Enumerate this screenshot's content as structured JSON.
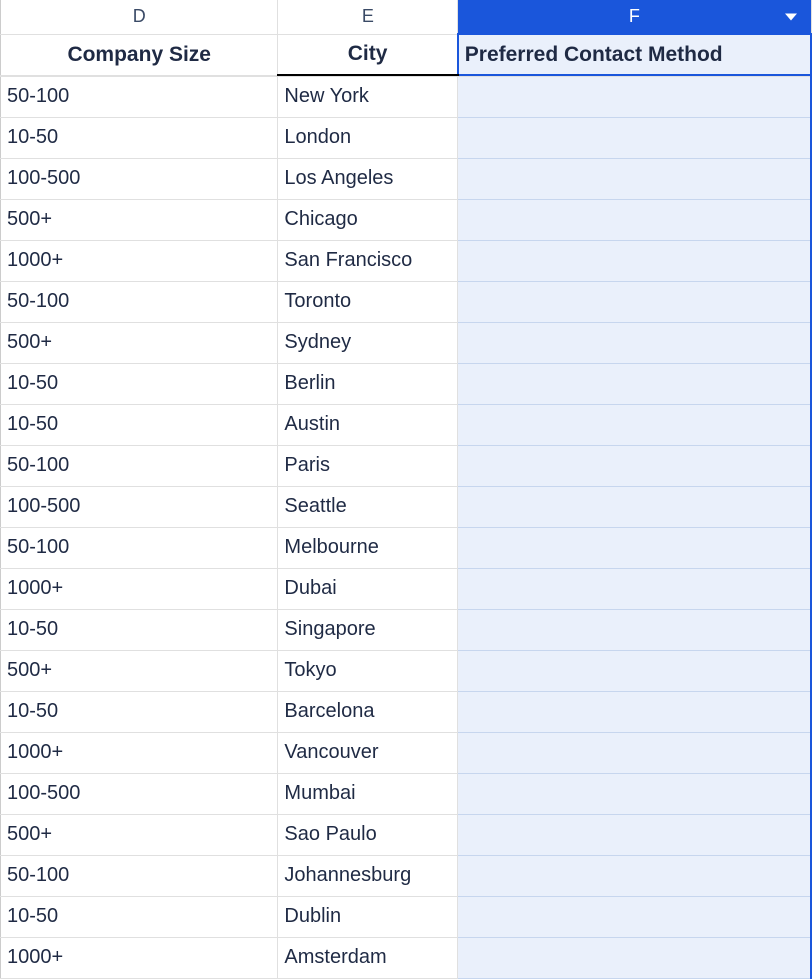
{
  "columns": {
    "d": {
      "letter": "D",
      "header": "Company Size"
    },
    "e": {
      "letter": "E",
      "header": "City"
    },
    "f": {
      "letter": "F",
      "header": "Preferred Contact Method"
    }
  },
  "rows": [
    {
      "company_size": "50-100",
      "city": "New York",
      "preferred_contact": ""
    },
    {
      "company_size": "10-50",
      "city": "London",
      "preferred_contact": ""
    },
    {
      "company_size": "100-500",
      "city": "Los Angeles",
      "preferred_contact": ""
    },
    {
      "company_size": "500+",
      "city": "Chicago",
      "preferred_contact": ""
    },
    {
      "company_size": "1000+",
      "city": "San Francisco",
      "preferred_contact": ""
    },
    {
      "company_size": "50-100",
      "city": "Toronto",
      "preferred_contact": ""
    },
    {
      "company_size": "500+",
      "city": "Sydney",
      "preferred_contact": ""
    },
    {
      "company_size": "10-50",
      "city": "Berlin",
      "preferred_contact": ""
    },
    {
      "company_size": "10-50",
      "city": "Austin",
      "preferred_contact": ""
    },
    {
      "company_size": "50-100",
      "city": "Paris",
      "preferred_contact": ""
    },
    {
      "company_size": "100-500",
      "city": "Seattle",
      "preferred_contact": ""
    },
    {
      "company_size": "50-100",
      "city": "Melbourne",
      "preferred_contact": ""
    },
    {
      "company_size": "1000+",
      "city": "Dubai",
      "preferred_contact": ""
    },
    {
      "company_size": "10-50",
      "city": "Singapore",
      "preferred_contact": ""
    },
    {
      "company_size": "500+",
      "city": "Tokyo",
      "preferred_contact": ""
    },
    {
      "company_size": "10-50",
      "city": "Barcelona",
      "preferred_contact": ""
    },
    {
      "company_size": "1000+",
      "city": "Vancouver",
      "preferred_contact": ""
    },
    {
      "company_size": "100-500",
      "city": "Mumbai",
      "preferred_contact": ""
    },
    {
      "company_size": "500+",
      "city": "Sao Paulo",
      "preferred_contact": ""
    },
    {
      "company_size": "50-100",
      "city": "Johannesburg",
      "preferred_contact": ""
    },
    {
      "company_size": "10-50",
      "city": "Dublin",
      "preferred_contact": ""
    },
    {
      "company_size": "1000+",
      "city": "Amsterdam",
      "preferred_contact": ""
    }
  ]
}
